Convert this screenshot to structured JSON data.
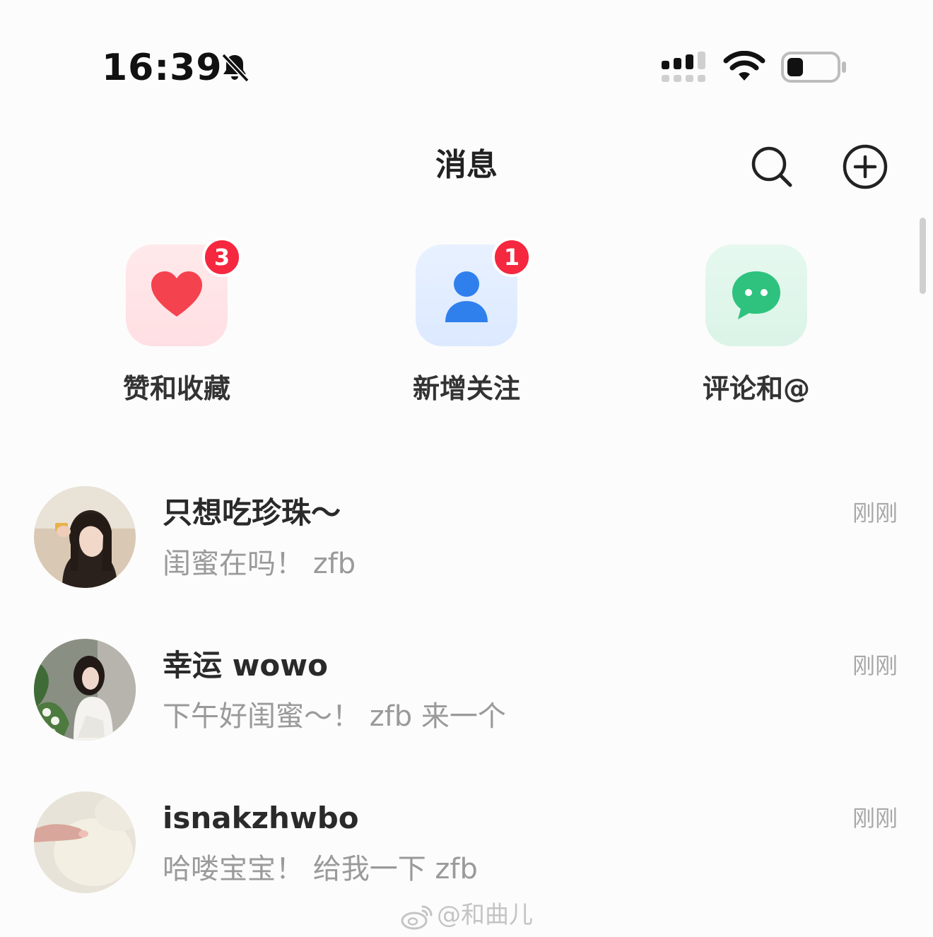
{
  "status_bar": {
    "time": "16:39",
    "icons": [
      "bell-muted-icon",
      "cellular-signal-icon",
      "wifi-icon",
      "battery-icon"
    ],
    "battery_level_fraction": 0.15
  },
  "nav": {
    "title": "消息",
    "icons": [
      "search-icon",
      "add-circle-icon"
    ]
  },
  "shortcuts": [
    {
      "label": "赞和收藏",
      "badge": "3",
      "icon": "heart-icon",
      "color": "#f5424f"
    },
    {
      "label": "新增关注",
      "badge": "1",
      "icon": "person-icon",
      "color": "#2f80ed"
    },
    {
      "label": "评论和@",
      "badge": "",
      "icon": "chat-bubble-icon",
      "color": "#2ec27e"
    }
  ],
  "conversations": [
    {
      "name": "只想吃珍珠～",
      "message": "闺蜜在吗！ zfb",
      "time": "刚刚"
    },
    {
      "name": "幸运 wowo",
      "message": "下午好闺蜜～！ zfb 来一个",
      "time": "刚刚"
    },
    {
      "name": "isnakzhwbo",
      "message": "哈喽宝宝！ 给我一下 zfb",
      "time": "刚刚"
    }
  ],
  "watermark": {
    "text": "@和曲儿",
    "icon": "weibo-icon"
  },
  "colors": {
    "badge": "#f5283f",
    "background": "#fcfcfc",
    "name_text": "#2a2a2a",
    "message_text": "#9a9a9a"
  }
}
